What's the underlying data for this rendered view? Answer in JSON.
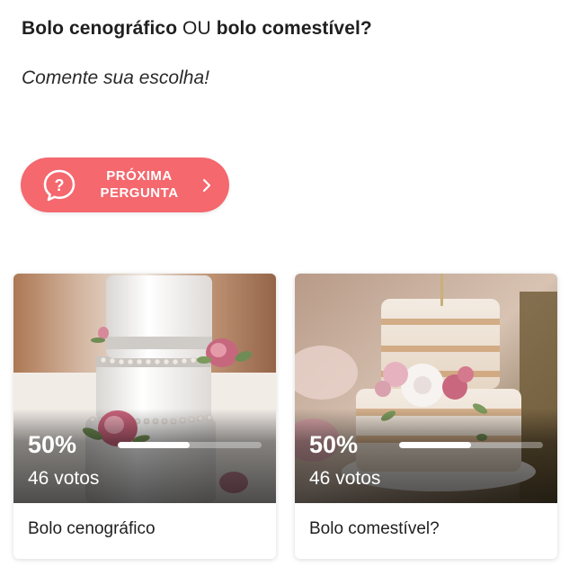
{
  "question": {
    "part1": "Bolo cenográfico",
    "connector": " OU ",
    "part2": "bolo comestível?"
  },
  "subtitle": "Comente sua escolha!",
  "next_button": {
    "line1": "PRÓXIMA",
    "line2": "PERGUNTA",
    "icon": "question-bubble-icon",
    "chevron": "chevron-right-icon"
  },
  "options": [
    {
      "label": "Bolo cenográfico",
      "percent_text": "50%",
      "percent": 0.5,
      "votes_text": "46 votos"
    },
    {
      "label": "Bolo comestível?",
      "percent_text": "50%",
      "percent": 0.5,
      "votes_text": "46 votos"
    }
  ],
  "colors": {
    "accent": "#f4686e",
    "text": "#1f1f1f"
  }
}
